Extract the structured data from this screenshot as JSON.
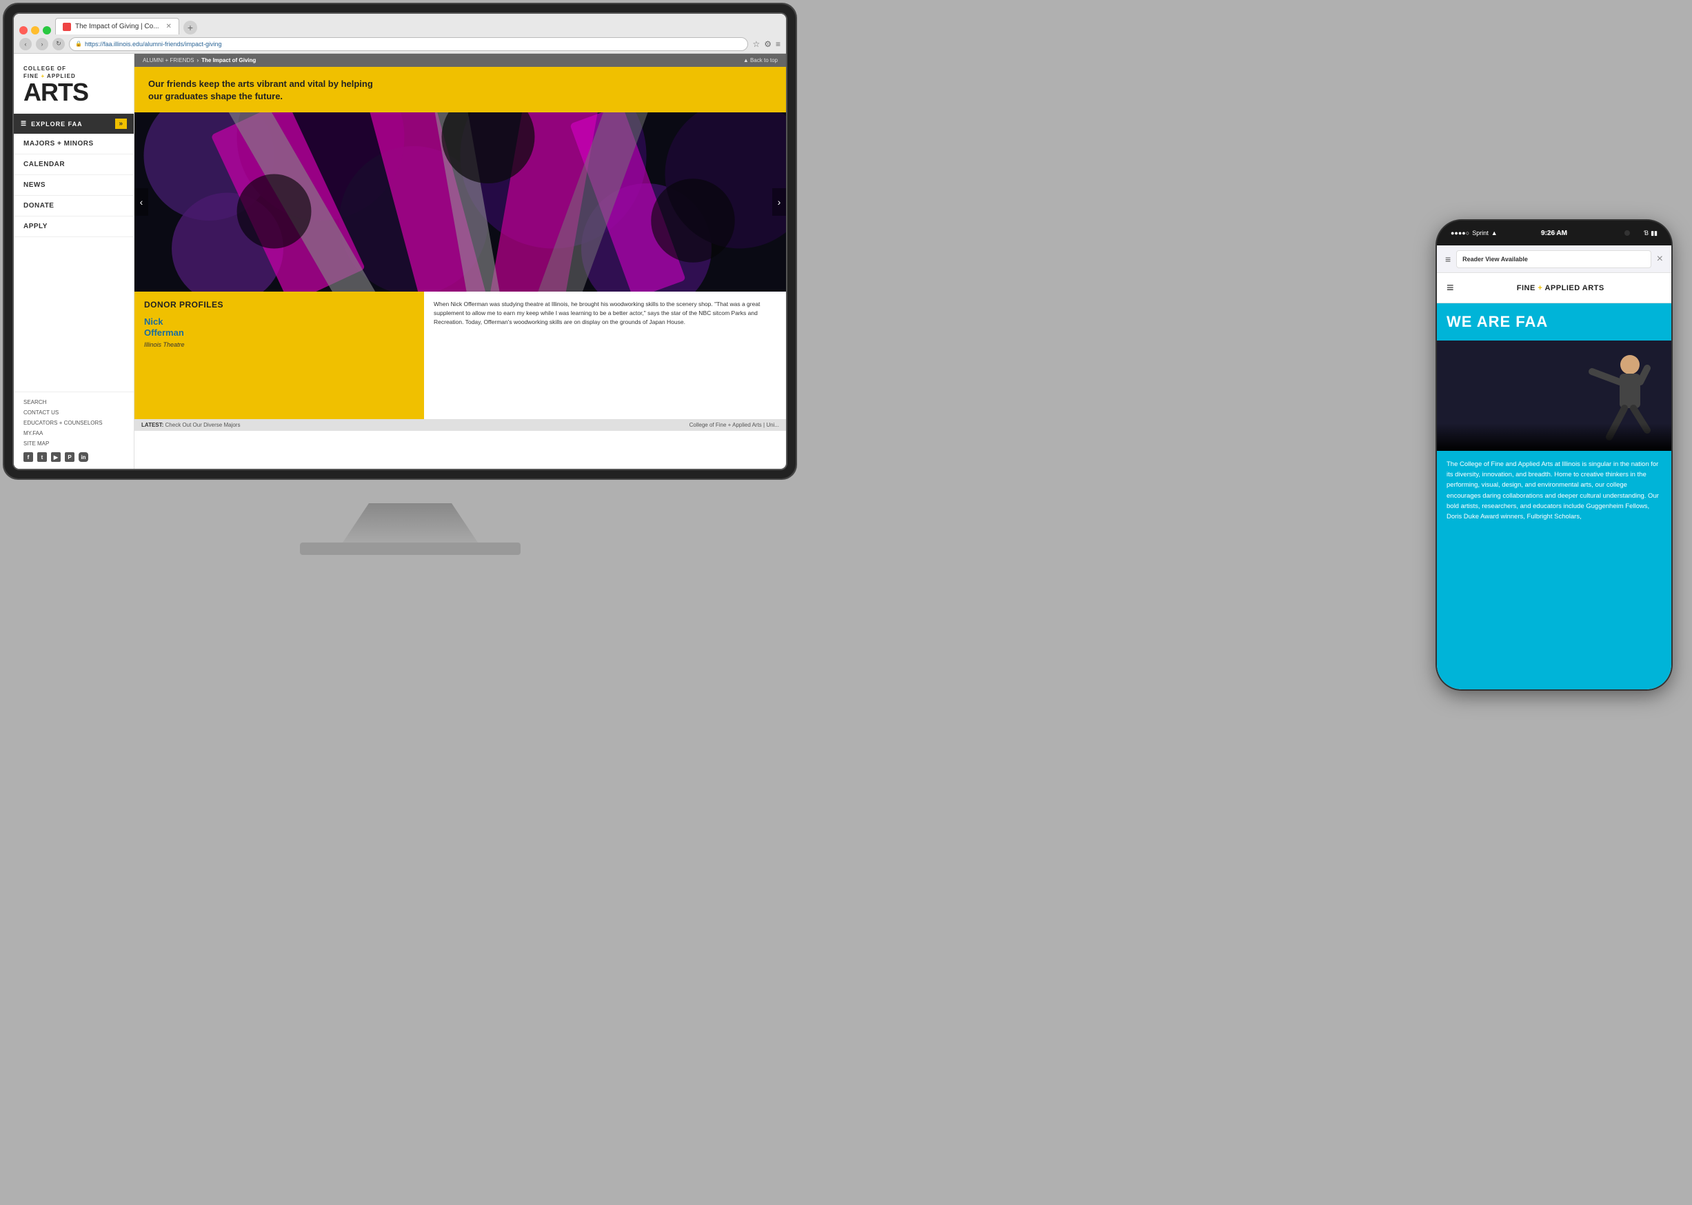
{
  "browser": {
    "tab_title": "The Impact of Giving | Co...",
    "url": "https://faa.illinois.edu/alumni-friends/impact-giving",
    "back_top_label": "▲ Back to top"
  },
  "breadcrumb": {
    "parent1": "ALUMNI + FRIENDS",
    "separator": " ",
    "current": "The Impact of Giving"
  },
  "sidebar": {
    "logo_line1": "COLLEGE OF",
    "logo_line2": "FINE + APPLIED",
    "logo_arts": "ARTS",
    "explore_label": "EXPLORE FAA",
    "nav_items": [
      {
        "label": "MAJORS + MINORS",
        "id": "majors-minors"
      },
      {
        "label": "CALENDAR",
        "id": "calendar"
      },
      {
        "label": "NEWS",
        "id": "news"
      },
      {
        "label": "DONATE",
        "id": "donate"
      },
      {
        "label": "APPLY",
        "id": "apply"
      }
    ],
    "bottom_links": [
      {
        "label": "SEARCH",
        "id": "search"
      },
      {
        "label": "CONTACT US",
        "id": "contact"
      },
      {
        "label": "EDUCATORS + COUNSELORS",
        "id": "educators"
      },
      {
        "label": "MY.FAA",
        "id": "my-faa"
      },
      {
        "label": "SITE MAP",
        "id": "site-map"
      }
    ],
    "social": [
      "f",
      "t",
      "▶",
      "P",
      "in"
    ]
  },
  "hero": {
    "banner_text": "Our friends keep the arts vibrant and vital by helping our graduates shape the future.",
    "donor_section_title": "DONOR PROFILES",
    "donor_name_line1": "Nick",
    "donor_name_line2": "Offerman",
    "donor_unit": "Illinois Theatre",
    "donor_quote": "When Nick Offerman was studying theatre at Illinois, he brought his woodworking skills to the scenery shop. \"That was a great supplement to allow me to earn my keep while I was learning to be a better actor,\" says the star of the NBC sitcom Parks and Recreation. Today, Offerman's woodworking skills are on display on the grounds of Japan House."
  },
  "bottom_bar": {
    "latest_label": "LATEST:",
    "latest_text": "Check Out Our Diverse Majors",
    "right_text": "College of Fine + Applied Arts | Uni..."
  },
  "phone": {
    "carrier": "Sprint",
    "wifi_icon": "wifi",
    "time": "9:26 AM",
    "battery_icon": "battery",
    "reader_view": "Reader View Available",
    "close_icon": "×",
    "site_title_part1": "FINE ",
    "plus": "+",
    "site_title_part2": " APPLIED ARTS",
    "hero_title": "WE ARE FAA",
    "body_text": "The College of Fine and Applied Arts at Illinois is singular in the nation for its diversity, innovation, and breadth. Home to creative thinkers in the performing, visual, design, and environmental arts, our college encourages daring collaborations and deeper cultural understanding. Our bold artists, researchers, and educators include Guggenheim Fellows, Doris Duke Award winners, Fulbright Scholars,"
  },
  "colors": {
    "yellow": "#f0c000",
    "blue": "#00b4d8",
    "dark": "#222222",
    "donor_blue": "#1a6e9e"
  }
}
